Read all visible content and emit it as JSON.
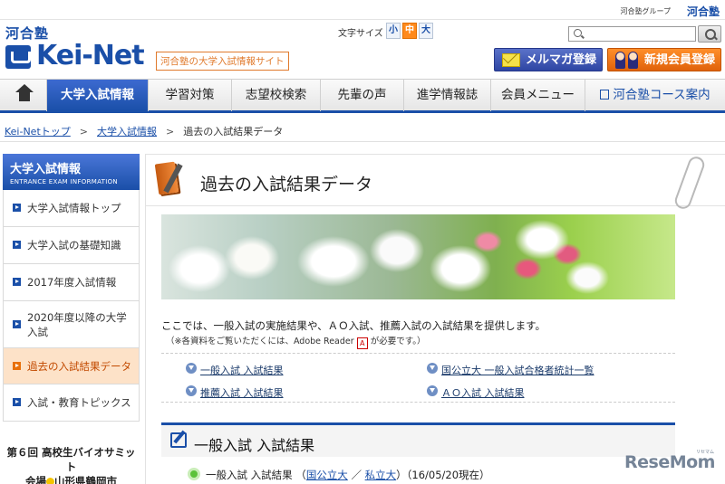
{
  "topbar": {
    "group_label": "河合塾グループ",
    "group_logo": "河合塾"
  },
  "header": {
    "logo_kanji": "河合塾",
    "logo_text": "Kei-Net",
    "tagline": "河合塾の大学入試情報サイト",
    "text_size_label": "文字サイズ",
    "text_sizes": [
      "小",
      "中",
      "大"
    ],
    "mail_button": "メルマガ登録",
    "member_button": "新規会員登録",
    "search_placeholder": ""
  },
  "nav": {
    "items": [
      "大学入試情報",
      "学習対策",
      "志望校検索",
      "先輩の声",
      "進学情報誌",
      "会員メニュー",
      "河合塾コース案内"
    ]
  },
  "breadcrumb": [
    "Kei-Netトップ",
    "大学入試情報",
    "過去の入試結果データ"
  ],
  "sidebar": {
    "title": "大学入試情報",
    "subtitle": "ENTRANCE EXAM INFORMATION",
    "items": [
      "大学入試情報トップ",
      "大学入試の基礎知識",
      "2017年度入試情報",
      "2020年度以降の大学入試",
      "過去の入試結果データ",
      "入試・教育トピックス"
    ],
    "banner_line1": "第６回 高校生バイオサミット",
    "banner_line2_a": "会場",
    "banner_line2_b": "山形県鶴岡市"
  },
  "main": {
    "title": "過去の入試結果データ",
    "intro": "ここでは、一般入試の実施結果や、ＡＯ入試、推薦入試の入試結果を提供します。",
    "note_a": "（※各資料をご覧いただくには、Adobe Reader",
    "note_b": "が必要です。）",
    "pdf_glyph": "A",
    "links": [
      "一般入試 入試結果",
      "国公立大 一般入試合格者統計一覧",
      "推薦入試 入試結果",
      "ＡＯ入試 入試結果"
    ],
    "section_title": "一般入試 入試結果",
    "result_label": "一般入試 入試結果 （",
    "result_link1": "国公立大",
    "result_sep": "／",
    "result_link2": "私立大",
    "result_tail": "）（16/05/20現在）"
  },
  "watermark": {
    "text": "ReseMom",
    "small": "リセマム"
  },
  "colors": {
    "brand_blue": "#1a4fa8",
    "accent_orange": "#e8700a",
    "member_orange": "#ff8f2a"
  }
}
